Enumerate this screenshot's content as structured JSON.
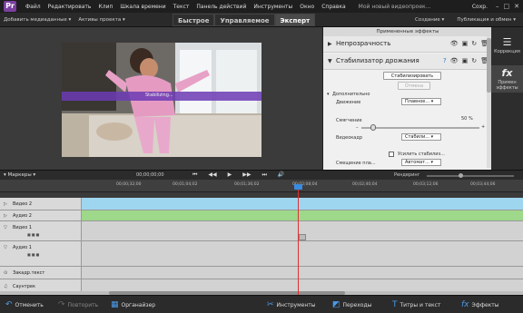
{
  "menubar": {
    "items": [
      "Файл",
      "Редактировать",
      "Клип",
      "Шкала времени",
      "Текст",
      "Панель действий",
      "Инструменты",
      "Окно",
      "Справка"
    ],
    "title": "Мой новый видеопроек...",
    "save_label": "Сохр."
  },
  "modebar": {
    "add_media": "Добавить медиаданные ▾",
    "project_assets": "Активы проекта ▾",
    "tabs": [
      "Быстрое",
      "Управляемое",
      "Эксперт"
    ],
    "active_tab": "Эксперт",
    "create": "Создание ▾",
    "publish": "Публикация и обмен ▾"
  },
  "monitor": {
    "overlay_text": "Stabilizing..."
  },
  "effects_panel": {
    "header": "Примененные эффекты",
    "opacity_label": "Непрозрачность",
    "stabilizer_label": "Стабилизатор дрожания",
    "stabilize_button": "Стабилизировать",
    "cancel_button": "Отмена",
    "advanced_label": "Дополнительно",
    "motion_label": "Движение",
    "motion_value": "Плавное...",
    "smoothing_label": "Смягчение",
    "smoothing_value": "50 %",
    "smoothing_fraction": 0.1,
    "framing_label": "Видеокадр",
    "framing_value": "Стабили...",
    "enhance_label": "Усилить стабилиз...",
    "offset_label": "Смещение пла...",
    "offset_value": "Автомат..."
  },
  "sidebar": {
    "adjust_label": "Коррекция",
    "applied_label": "Примен эффекты"
  },
  "timeline": {
    "markers_label": "Маркеры",
    "timecode": "00;00;00;00",
    "render_label": "Рендеринг",
    "ticks": [
      "00;00;32;00",
      "00;01;04;02",
      "00;01;36;02",
      "00;02;08;04",
      "00;02;40;04",
      "00;03;12;06",
      "00;03;44;06"
    ],
    "tracks": [
      "Видео 2",
      "Аудио 2",
      "Видео 1",
      "Аудио 1",
      "Закадр.текст",
      "Саунтрек"
    ]
  },
  "bottombar": {
    "undo": "Отменить",
    "redo": "Повторить",
    "organizer": "Органайзер",
    "tools": "Инструменты",
    "transitions": "Переходы",
    "titles": "Титры и текст",
    "effects": "Эффекты"
  },
  "colors": {
    "accent": "#6c3bb5",
    "video_track": "#9fd6ef",
    "audio_track": "#9ed88a",
    "playhead": "#e03030"
  }
}
